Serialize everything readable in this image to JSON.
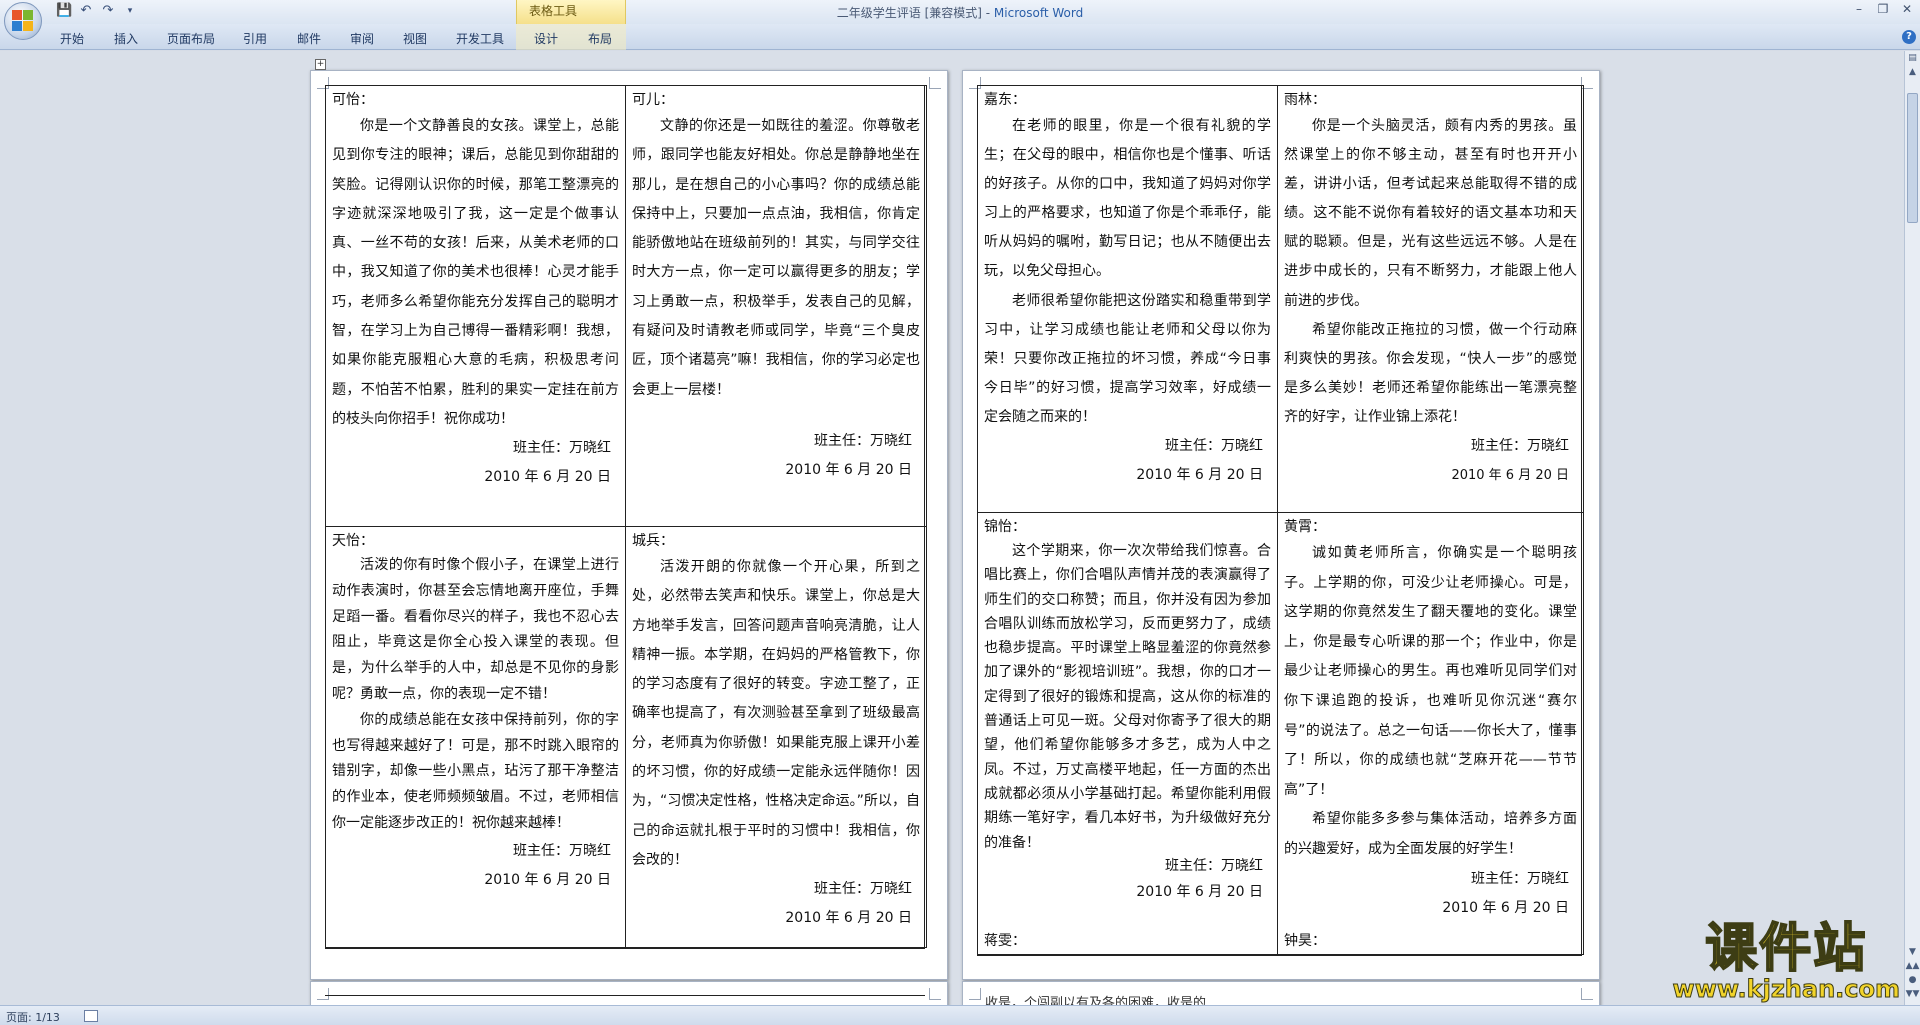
{
  "window": {
    "title": "二年级学生评语 [兼容模式] - Microsoft Word",
    "title_doc": "二年级学生评语 [兼容模式] - ",
    "title_app": "Microsoft Word"
  },
  "ribbon": {
    "contextual_group": "表格工具",
    "tabs": [
      "开始",
      "插入",
      "页面布局",
      "引用",
      "邮件",
      "审阅",
      "视图",
      "开发工具",
      "设计",
      "布局"
    ]
  },
  "page1": {
    "cells": [
      {
        "name": "可怡：",
        "paras": [
          "你是一个文静善良的女孩。课堂上，总能见到你专注的眼神；课后，总能见到你甜甜的笑脸。记得刚认识你的时候，那笔工整漂亮的字迹就深深地吸引了我，这一定是个做事认真、一丝不苟的女孩！后来，从美术老师的口中，我又知道了你的美术也很棒！心灵才能手巧，老师多么希望你能充分发挥自己的聪明才智，在学习上为自己博得一番精彩啊！我想，如果你能克服粗心大意的毛病，积极思考问题，不怕苦不怕累，胜利的果实一定挂在前方的枝头向你招手！祝你成功！"
        ],
        "teacher": "班主任：万晓红",
        "date": "2010 年 6 月 20 日"
      },
      {
        "name": "可儿：",
        "paras": [
          "文静的你还是一如既往的羞涩。你尊敬老师，跟同学也能友好相处。你总是静静地坐在那儿，是在想自己的小心事吗？你的成绩总能保持中上，只要加一点点油，我相信，你肯定能骄傲地站在班级前列的！其实，与同学交往时大方一点，你一定可以赢得更多的朋友；学习上勇敢一点，积极举手，发表自己的见解，有疑问及时请教老师或同学，毕竟“三个臭皮匠，顶个诸葛亮”嘛！我相信，你的学习必定也会更上一层楼！"
        ],
        "teacher": "班主任：万晓红",
        "date": "2010 年 6 月 20 日"
      },
      {
        "name": "天怡：",
        "paras": [
          "活泼的你有时像个假小子，在课堂上进行动作表演时，你甚至会忘情地离开座位，手舞足蹈一番。看看你尽兴的样子，我也不忍心去阻止，毕竟这是你全心投入课堂的表现。但是，为什么举手的人中，却总是不见你的身影呢？勇敢一点，你的表现一定不错！",
          "你的成绩总能在女孩中保持前列，你的字也写得越来越好了！可是，那不时跳入眼帘的错别字，却像一些小黑点，玷污了那干净整洁的作业本，使老师频频皱眉。不过，老师相信你一定能逐步改正的！祝你越来越棒！"
        ],
        "teacher": "班主任：万晓红",
        "date": "2010 年 6 月 20 日"
      },
      {
        "name": "城兵：",
        "paras": [
          "活泼开朗的你就像一个开心果，所到之处，必然带去笑声和快乐。课堂上，你总是大方地举手发言，回答问题声音响亮清脆，让人精神一振。本学期，在妈妈的严格管教下，你的学习态度有了很好的转变。字迹工整了，正确率也提高了，有次测验甚至拿到了班级最高分，老师真为你骄傲！如果能克服上课开小差的坏习惯，你的好成绩一定能永远伴随你！因为，“习惯决定性格，性格决定命运。”所以，自己的命运就扎根于平时的习惯中！我相信，你会改的！"
        ],
        "teacher": "班主任：万晓红",
        "date": "2010 年 6 月 20 日"
      }
    ]
  },
  "page2": {
    "cells": [
      {
        "name": "嘉东：",
        "paras": [
          "在老师的眼里，你是一个很有礼貌的学生；在父母的眼中，相信你也是个懂事、听话的好孩子。从你的口中，我知道了妈妈对你学习上的严格要求，也知道了你是个乖乖仔，能听从妈妈的嘱咐，勤写日记；也从不随便出去玩，以免父母担心。",
          "老师很希望你能把这份踏实和稳重带到学习中，让学习成绩也能让老师和父母以你为荣！只要你改正拖拉的坏习惯，养成“今日事今日毕”的好习惯，提高学习效率，好成绩一定会随之而来的！"
        ],
        "teacher": "班主任：万晓红",
        "date": "2010 年 6 月 20 日"
      },
      {
        "name": "雨林：",
        "paras": [
          "你是一个头脑灵活，颇有内秀的男孩。虽然课堂上的你不够主动，甚至有时也开开小差，讲讲小话，但考试起来总能取得不错的成绩。这不能不说你有着较好的语文基本功和天赋的聪颖。但是，光有这些远远不够。人是在进步中成长的，只有不断努力，才能跟上他人前进的步伐。",
          "希望你能改正拖拉的习惯，做一个行动麻利爽快的男孩。你会发现，“快人一步”的感觉是多么美妙！老师还希望你能练出一笔漂亮整齐的好字，让作业锦上添花！"
        ],
        "teacher": "班主任：万晓红",
        "date": "2010 年 6 月 20 日"
      },
      {
        "name": "锦怡：",
        "paras": [
          "这个学期来，你一次次带给我们惊喜。合唱比赛上，你们合唱队声情并茂的表演赢得了师生们的交口称赞；而且，你并没有因为参加合唱队训练而放松学习，反而更努力了，成绩也稳步提高。平时课堂上略显羞涩的你竟然参加了课外的“影视培训班”。我想，你的口才一定得到了很好的锻炼和提高，这从你的标准的普通话上可见一斑。父母对你寄予了很大的期望，他们希望你能够多才多艺，成为人中之凤。不过，万丈高楼平地起，任一方面的杰出成就都必须从小学基础打起。希望你能利用假期练一笔好字，看几本好书，为升级做好充分的准备！"
        ],
        "teacher": "班主任：万晓红",
        "date": "2010 年 6 月 20 日",
        "next_name": "蒋雯："
      },
      {
        "name": "黄霄：",
        "paras": [
          "诚如黄老师所言，你确实是一个聪明孩子。上学期的你，可没少让老师操心。可是，这学期的你竟然发生了翻天覆地的变化。课堂上，你是最专心听课的那一个；作业中，你是最少让老师操心的男生。再也难听见同学们对你下课追跑的投诉，也难听见你沉迷“赛尔号”的说法了。总之一句话——你长大了，懂事了！所以，你的成绩也就“芝麻开花——节节高”了！",
          "希望你能多多参与集体活动，培养多方面的兴趣爱好，成为全面发展的好学生！"
        ],
        "teacher": "班主任：万晓红",
        "date": "2010 年 6 月 20 日",
        "next_name": "钟昊："
      }
    ]
  },
  "page4_fragment": "收是，个闯副以有及各的困难，收是的",
  "statusbar": {
    "page_indicator": "页面: 1/13"
  },
  "watermark": {
    "title": "课件站",
    "url": "www.kjzhan.com"
  }
}
